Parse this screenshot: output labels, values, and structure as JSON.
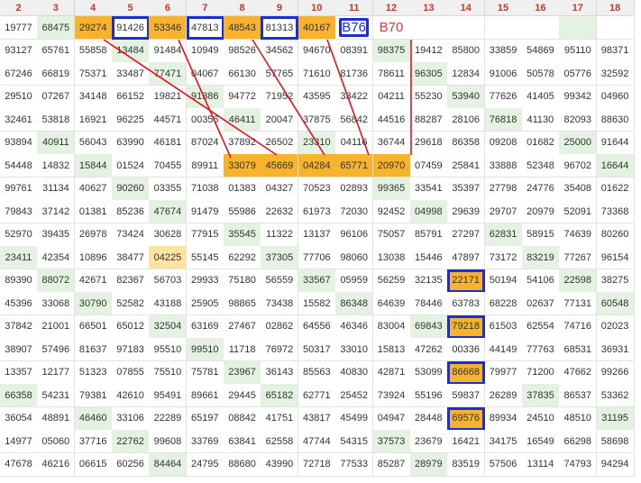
{
  "columns": [
    "2",
    "3",
    "4",
    "5",
    "6",
    "7",
    "8",
    "9",
    "10",
    "11",
    "12",
    "13",
    "14",
    "15",
    "16",
    "17",
    "18"
  ],
  "rows": [
    [
      "19777",
      "68475",
      "29274",
      "91426",
      "53346",
      "47813",
      "48543",
      "81313",
      "40167",
      "B76",
      "B70",
      "",
      "",
      "",
      "",
      "",
      ""
    ],
    [
      "93127",
      "65761",
      "55858",
      "13484",
      "91484",
      "10949",
      "98526",
      "34562",
      "94670",
      "08391",
      "98375",
      "19412",
      "85800",
      "33859",
      "54869",
      "95110",
      "98371"
    ],
    [
      "67246",
      "66819",
      "75371",
      "33487",
      "77471",
      "04067",
      "66130",
      "57765",
      "71610",
      "81736",
      "78611",
      "96305",
      "12834",
      "91006",
      "50578",
      "05776",
      "32592"
    ],
    [
      "29510",
      "07267",
      "34148",
      "66152",
      "19821",
      "91386",
      "94772",
      "71952",
      "43595",
      "33422",
      "04211",
      "55230",
      "53940",
      "77626",
      "41405",
      "99342",
      "04960"
    ],
    [
      "32461",
      "53818",
      "16921",
      "96225",
      "44571",
      "00356",
      "46411",
      "20047",
      "37875",
      "56842",
      "44516",
      "88287",
      "28106",
      "76818",
      "41130",
      "82093",
      "88630"
    ],
    [
      "93894",
      "40911",
      "56043",
      "63990",
      "46181",
      "87024",
      "37892",
      "26502",
      "23310",
      "04116",
      "36744",
      "29618",
      "86358",
      "09208",
      "01682",
      "25000",
      "91644"
    ],
    [
      "54448",
      "14832",
      "15844",
      "01524",
      "70455",
      "89911",
      "33079",
      "45669",
      "04284",
      "65771",
      "20970",
      "07459",
      "25841",
      "33888",
      "52348",
      "96702",
      "16644"
    ],
    [
      "99761",
      "31134",
      "40627",
      "90260",
      "03355",
      "71038",
      "01383",
      "04327",
      "70523",
      "02893",
      "99365",
      "33541",
      "35397",
      "27798",
      "24776",
      "35408",
      "01622"
    ],
    [
      "79843",
      "37142",
      "01381",
      "85236",
      "47674",
      "91479",
      "55986",
      "22632",
      "61973",
      "72030",
      "92452",
      "04998",
      "29639",
      "29707",
      "20979",
      "52091",
      "73368"
    ],
    [
      "52970",
      "39435",
      "26978",
      "73424",
      "30628",
      "77915",
      "35545",
      "11322",
      "13137",
      "96106",
      "75057",
      "85791",
      "27297",
      "62831",
      "58915",
      "74639",
      "80260"
    ],
    [
      "23411",
      "42354",
      "10896",
      "38477",
      "04225",
      "55145",
      "62292",
      "37305",
      "77706",
      "98060",
      "13038",
      "15446",
      "47897",
      "73172",
      "83219",
      "77267",
      "96154"
    ],
    [
      "89390",
      "88072",
      "42671",
      "82367",
      "56703",
      "29933",
      "75180",
      "56559",
      "33567",
      "05959",
      "56259",
      "32135",
      "22171",
      "50194",
      "54106",
      "22598",
      "38275"
    ],
    [
      "45396",
      "33068",
      "30790",
      "52582",
      "43188",
      "25905",
      "98865",
      "73438",
      "15582",
      "86348",
      "64639",
      "78446",
      "63783",
      "68228",
      "02637",
      "77131",
      "60548"
    ],
    [
      "37842",
      "21001",
      "66501",
      "65012",
      "32504",
      "63169",
      "27467",
      "02862",
      "64556",
      "46346",
      "83004",
      "69843",
      "79218",
      "61503",
      "62554",
      "74716",
      "02023"
    ],
    [
      "38907",
      "57496",
      "81637",
      "97183",
      "95510",
      "99510",
      "11718",
      "76972",
      "50317",
      "33010",
      "15813",
      "47262",
      "00336",
      "44149",
      "77763",
      "68531",
      "36931"
    ],
    [
      "13357",
      "12177",
      "51323",
      "07855",
      "75510",
      "75781",
      "23967",
      "36143",
      "85563",
      "40830",
      "42871",
      "53099",
      "86668",
      "79977",
      "71200",
      "47662",
      "99266"
    ],
    [
      "66358",
      "54231",
      "79381",
      "42610",
      "95491",
      "89661",
      "29445",
      "65182",
      "62771",
      "25452",
      "73924",
      "55196",
      "59837",
      "26289",
      "37835",
      "86537",
      "53362"
    ],
    [
      "36054",
      "48891",
      "46460",
      "33106",
      "22289",
      "65197",
      "08842",
      "41751",
      "43817",
      "45499",
      "04947",
      "28448",
      "69576",
      "89934",
      "24510",
      "48510",
      "31195"
    ],
    [
      "14977",
      "05060",
      "37716",
      "22762",
      "99608",
      "33769",
      "63841",
      "62558",
      "47744",
      "54315",
      "37573",
      "23679",
      "16421",
      "34175",
      "16549",
      "66298",
      "58698"
    ],
    [
      "47678",
      "46216",
      "06615",
      "60256",
      "84464",
      "24795",
      "88680",
      "43990",
      "72718",
      "77533",
      "85287",
      "28979",
      "83519",
      "57506",
      "13114",
      "74793",
      "94294"
    ]
  ]
}
